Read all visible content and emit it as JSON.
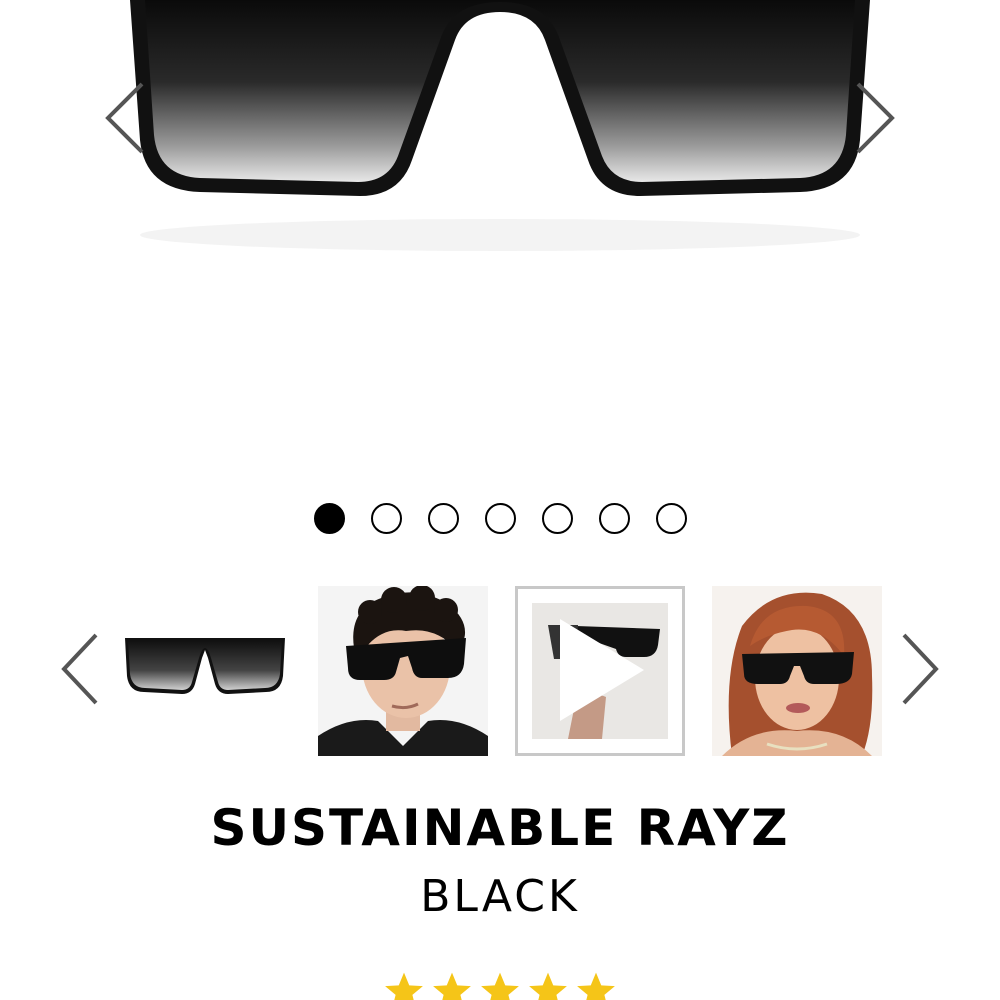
{
  "product": {
    "name": "SUSTAINABLE RAYZ",
    "color": "BLACK",
    "rating": 5,
    "rating_max": 5
  },
  "gallery": {
    "total_slides": 7,
    "active_index": 0
  },
  "thumbnails": [
    {
      "kind": "product"
    },
    {
      "kind": "model-male"
    },
    {
      "kind": "video"
    },
    {
      "kind": "model-female"
    }
  ],
  "icons": {
    "prev": "chevron-left-icon",
    "next": "chevron-right-icon",
    "play": "play-icon",
    "star": "star-icon"
  },
  "colors": {
    "star": "#f5c518",
    "arrow": "#555555",
    "thumb_border": "#c8c8c8"
  }
}
